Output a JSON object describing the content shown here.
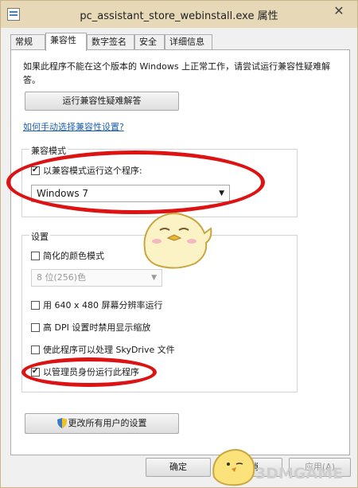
{
  "window": {
    "title": "pc_assistant_store_webinstall.exe 属性",
    "close": "✕"
  },
  "tabs": [
    {
      "label": "常规"
    },
    {
      "label": "兼容性"
    },
    {
      "label": "数字签名"
    },
    {
      "label": "安全"
    },
    {
      "label": "详细信息"
    }
  ],
  "intro": "如果此程序不能在这个版本的 Windows 上正常工作，请尝试运行兼容性疑难解答。",
  "troubleshoot_button": "运行兼容性疑难解答",
  "manual_link": "如何手动选择兼容性设置?",
  "compat_mode": {
    "label": "兼容模式",
    "checkbox_label": "以兼容模式运行这个程序:",
    "checked": true,
    "selected_os": "Windows 7"
  },
  "settings": {
    "label": "设置",
    "items": [
      {
        "label": "简化的颜色模式",
        "checked": false
      },
      {
        "label": "用 640 x 480 屏幕分辨率运行",
        "checked": false
      },
      {
        "label": "高 DPI 设置时禁用显示缩放",
        "checked": false
      },
      {
        "label": "使此程序可以处理 SkyDrive 文件",
        "checked": false
      },
      {
        "label": "以管理员身份运行此程序",
        "checked": true
      }
    ],
    "color_select": "8 位(256)色"
  },
  "change_all_button": "更改所有用户的设置",
  "footer": {
    "ok": "确定",
    "cancel": "取消",
    "apply": "应用(A)"
  },
  "watermark": "3DMGAME",
  "accent": "#dd1212"
}
